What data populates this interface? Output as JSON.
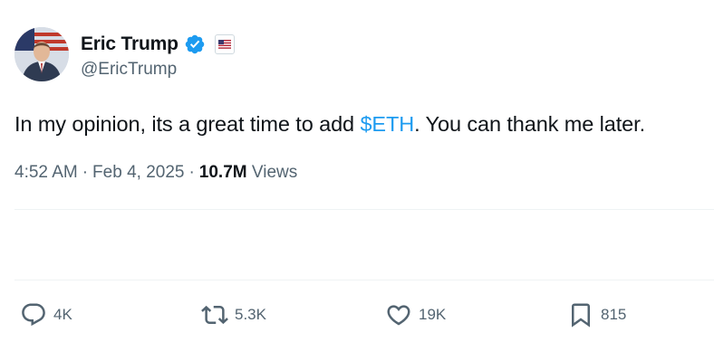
{
  "author": {
    "display_name": "Eric Trump",
    "handle": "@EricTrump",
    "verified_icon": "verified-badge-icon",
    "affiliation_icon": "us-flag-icon",
    "brand_color": "#1d9bf0"
  },
  "tweet": {
    "text_before": "In my opinion, its a great time to add ",
    "cashtag": "$ETH",
    "text_after": ". You can thank me later."
  },
  "meta": {
    "time": "4:52 AM",
    "separator": "·",
    "date": "Feb 4, 2025",
    "views_count": "10.7M",
    "views_label": "Views"
  },
  "actions": {
    "reply_count": "4K",
    "retweet_count": "5.3K",
    "like_count": "19K",
    "bookmark_count": "815"
  }
}
